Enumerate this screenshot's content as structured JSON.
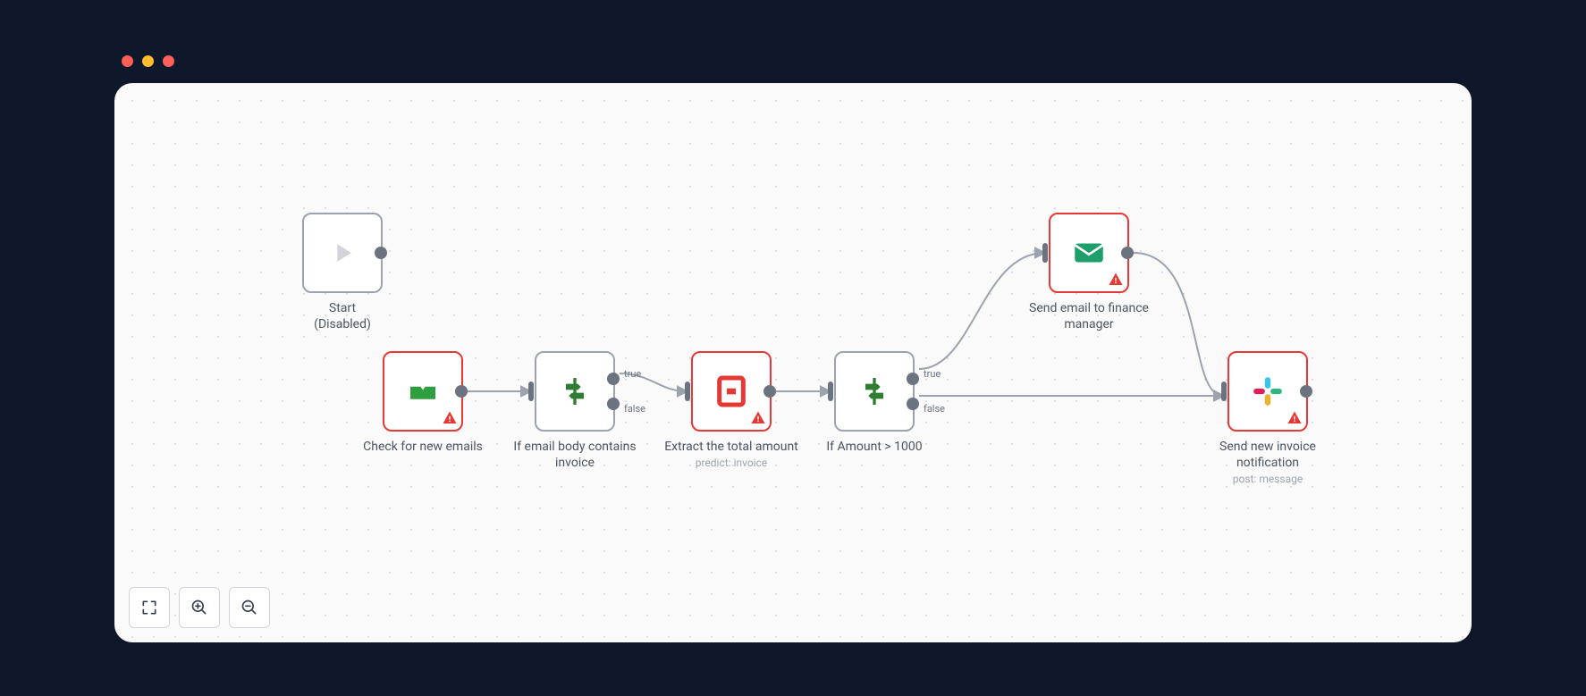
{
  "titlebar": {
    "dots": [
      "red",
      "yellow",
      "green"
    ]
  },
  "nodes": {
    "start": {
      "label_line1": "Start",
      "label_line2": "(Disabled)"
    },
    "check_emails": {
      "label": "Check for new emails"
    },
    "if_body": {
      "label": "If email body contains invoice",
      "out_true": "true",
      "out_false": "false"
    },
    "extract": {
      "label": "Extract the total amount",
      "sublabel": "predict: invoice"
    },
    "if_amount": {
      "label": "If Amount > 1000",
      "out_true": "true",
      "out_false": "false"
    },
    "send_email": {
      "label": "Send email to finance manager"
    },
    "send_slack": {
      "label": "Send new invoice notification",
      "sublabel": "post: message"
    }
  },
  "controls": {
    "fit": "fit-view",
    "zoom_in": "zoom-in",
    "zoom_out": "zoom-out"
  }
}
